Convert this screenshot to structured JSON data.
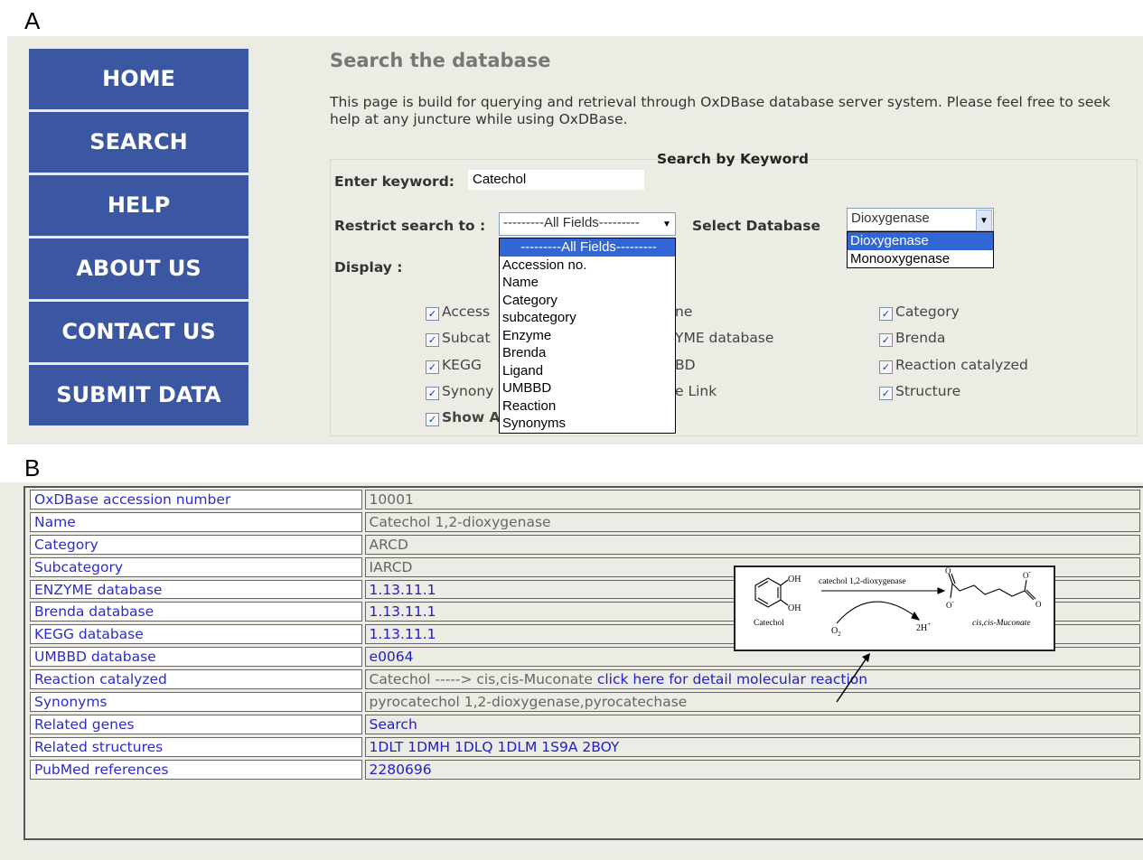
{
  "panel_labels": {
    "a": "A",
    "b": "B"
  },
  "nav": {
    "items": [
      "HOME",
      "SEARCH",
      "HELP",
      "ABOUT US",
      "CONTACT US",
      "SUBMIT DATA"
    ]
  },
  "search_page": {
    "title": "Search the database",
    "intro": "This page is build for querying and retrieval through OxDBase database server system. Please feel free to seek help at any juncture while using OxDBase.",
    "legend": "Search by Keyword",
    "keyword_label": "Enter keyword:",
    "keyword_value": "Catechol",
    "restrict_label": "Restrict search to :",
    "restrict_value": "---------All Fields---------",
    "restrict_options": [
      "---------All Fields---------",
      "Accession no.",
      "Name",
      "Category",
      "subcategory",
      "Enzyme",
      "Brenda",
      "Ligand",
      "UMBBD",
      "Reaction",
      "Synonyms"
    ],
    "db_label": "Select Database",
    "db_value": "Dioxygenase",
    "db_options": [
      "Dioxygenase",
      "Monooxygenase"
    ],
    "display_label": "Display :",
    "checkboxes": {
      "col1": [
        "Access",
        "Subcat",
        "KEGG",
        "Synony"
      ],
      "col1_bold": "Show A",
      "col2": [
        "ne",
        "YME database",
        "BD",
        "e Link"
      ],
      "col3": [
        "Category",
        "Brenda",
        "Reaction catalyzed",
        "Structure"
      ]
    }
  },
  "record": {
    "rows": [
      {
        "key": "OxDBase accession number",
        "value": "10001",
        "link": false
      },
      {
        "key": "Name",
        "value": "Catechol 1,2-dioxygenase",
        "link": false
      },
      {
        "key": "Category",
        "value": "ARCD",
        "link": false
      },
      {
        "key": "Subcategory",
        "value": "IARCD",
        "link": false
      },
      {
        "key": "ENZYME database",
        "value": "1.13.11.1",
        "link": true
      },
      {
        "key": "Brenda database",
        "value": "1.13.11.1",
        "link": true
      },
      {
        "key": "KEGG database",
        "value": "1.13.11.1",
        "link": true
      },
      {
        "key": "UMBBD database",
        "value": "e0064",
        "link": true
      },
      {
        "key": "Reaction catalyzed",
        "value": "Catechol -----> cis,cis-Muconate ",
        "link_text": "click here for detail molecular reaction",
        "link": false
      },
      {
        "key": "Synonyms",
        "value": "pyrocatechol 1,2-dioxygenase,pyrocatechase",
        "link": false
      },
      {
        "key": "Related genes",
        "value": "Search",
        "link": true
      },
      {
        "key": "Related structures",
        "value": "1DLT 1DMH 1DLQ 1DLM 1S9A 2BOY",
        "link": true
      },
      {
        "key": "PubMed references",
        "value": "2280696",
        "link": true
      }
    ]
  },
  "reaction_figure": {
    "enzyme": "catechol 1,2-dioxygenase",
    "substrate": "Catechol",
    "product": "cis,cis-Muconate",
    "oh": "OH",
    "cosubstrate": "O",
    "cosubstrate_sub": "2",
    "byproduct": "2H",
    "byproduct_sup": "+",
    "atom_o": "O",
    "charge": "-"
  }
}
